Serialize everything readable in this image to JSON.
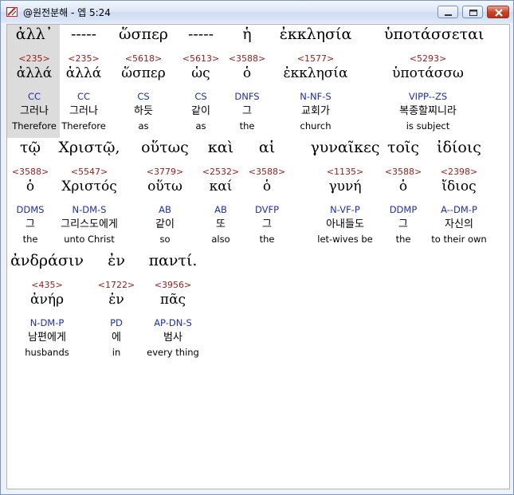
{
  "window": {
    "title": "@원전분해 - 엡 5:24",
    "minimize_label": "",
    "maximize_label": "",
    "close_label": ""
  },
  "rows": [
    [
      {
        "greek": "ἀλλ᾽",
        "num": "<235>",
        "lemma": "ἀλλά",
        "parse": "CC",
        "kor": "그러나",
        "eng": "Therefore"
      },
      {
        "greek": "-----",
        "num": "<235>",
        "lemma": "ἀλλά",
        "parse": "CC",
        "kor": "그러나",
        "eng": "Therefore"
      },
      {
        "greek": "ὥσπερ",
        "num": "<5618>",
        "lemma": "ὥσπερ",
        "parse": "CS",
        "kor": "하듯",
        "eng": "as"
      },
      {
        "greek": "-----",
        "num": "<5613>",
        "lemma": "ὡς",
        "parse": "CS",
        "kor": "같이",
        "eng": "as"
      },
      {
        "greek": "ἡ",
        "num": "<3588>",
        "lemma": "ὁ",
        "parse": "DNFS",
        "kor": "그",
        "eng": "the"
      },
      {
        "greek": "ἐκκλησία",
        "num": "<1577>",
        "lemma": "ἐκκλησία",
        "parse": "N-NF-S",
        "kor": "교회가",
        "eng": "church"
      },
      {
        "greek": "ὑποτάσσεται",
        "num": "<5293>",
        "lemma": "ὑποτάσσω",
        "parse": "VIPP--ZS",
        "kor": "복종할찌니라",
        "eng": "is subject"
      }
    ],
    [
      {
        "greek": "τῷ",
        "num": "<3588>",
        "lemma": "ὁ",
        "parse": "DDMS",
        "kor": "그",
        "eng": "the"
      },
      {
        "greek": "Χριστῷ,",
        "num": "<5547>",
        "lemma": "Χριστός",
        "parse": "N-DM-S",
        "kor": "그리스도에게",
        "eng": "unto Christ"
      },
      {
        "greek": "οὕτως",
        "num": "<3779>",
        "lemma": "οὕτω",
        "parse": "AB",
        "kor": "같이",
        "eng": "so"
      },
      {
        "greek": "καὶ",
        "num": "<2532>",
        "lemma": "καί",
        "parse": "AB",
        "kor": "또",
        "eng": "also"
      },
      {
        "greek": "αἱ",
        "num": "<3588>",
        "lemma": "ὁ",
        "parse": "DVFP",
        "kor": "그",
        "eng": "the"
      },
      {
        "greek": "γυναῖκες",
        "num": "<1135>",
        "lemma": "γυνή",
        "parse": "N-VF-P",
        "kor": "아내들도",
        "eng": "let-wives be"
      },
      {
        "greek": "τοῖς",
        "num": "<3588>",
        "lemma": "ὁ",
        "parse": "DDMP",
        "kor": "그",
        "eng": "the"
      },
      {
        "greek": "ἰδίοις",
        "num": "<2398>",
        "lemma": "ἴδιος",
        "parse": "A--DM-P",
        "kor": "자신의",
        "eng": "to their own"
      }
    ],
    [
      {
        "greek": "ἀνδράσιν",
        "num": "<435>",
        "lemma": "ἀνήρ",
        "parse": "N-DM-P",
        "kor": "남편에게",
        "eng": "husbands"
      },
      {
        "greek": "ἐν",
        "num": "<1722>",
        "lemma": "ἐν",
        "parse": "PD",
        "kor": "에",
        "eng": "in"
      },
      {
        "greek": "παντί.",
        "num": "<3956>",
        "lemma": "πᾶς",
        "parse": "AP-DN-S",
        "kor": "범사",
        "eng": "every thing"
      }
    ]
  ],
  "colors": {
    "strongs_number": "#9b1a1a",
    "parsing_code": "#1f2fa8",
    "selection": "#dcdcdc"
  },
  "icons": {
    "app": "bible-app-icon",
    "minimize": "minimize-icon",
    "maximize": "maximize-icon",
    "close": "close-icon"
  }
}
